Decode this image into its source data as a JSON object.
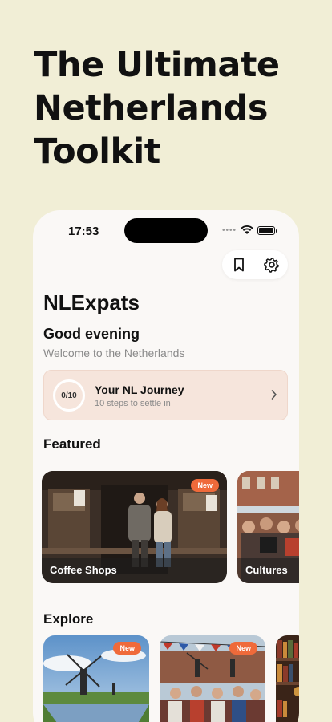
{
  "headline": "The Ultimate Netherlands Toolkit",
  "status_bar": {
    "time": "17:53"
  },
  "toolbar": {
    "bookmark_icon": "bookmark-icon",
    "settings_icon": "gear-icon"
  },
  "app": {
    "title": "NLExpats",
    "greeting": "Good evening",
    "welcome": "Welcome to the Netherlands"
  },
  "journey": {
    "progress_label": "0/10",
    "progress": 0,
    "title": "Your NL Journey",
    "subtitle": "10 steps to settle in"
  },
  "featured": {
    "heading": "Featured",
    "cards": [
      {
        "label": "Coffee Shops",
        "badge": "New"
      },
      {
        "label": "Cultures",
        "badge": ""
      }
    ]
  },
  "explore": {
    "heading": "Explore",
    "cards": [
      {
        "badge": "New"
      },
      {
        "badge": "New"
      },
      {
        "badge": ""
      }
    ]
  },
  "colors": {
    "accent": "#ef6a3a",
    "page_bg": "#f1eed6",
    "journey_bg": "#f6e5dc"
  }
}
